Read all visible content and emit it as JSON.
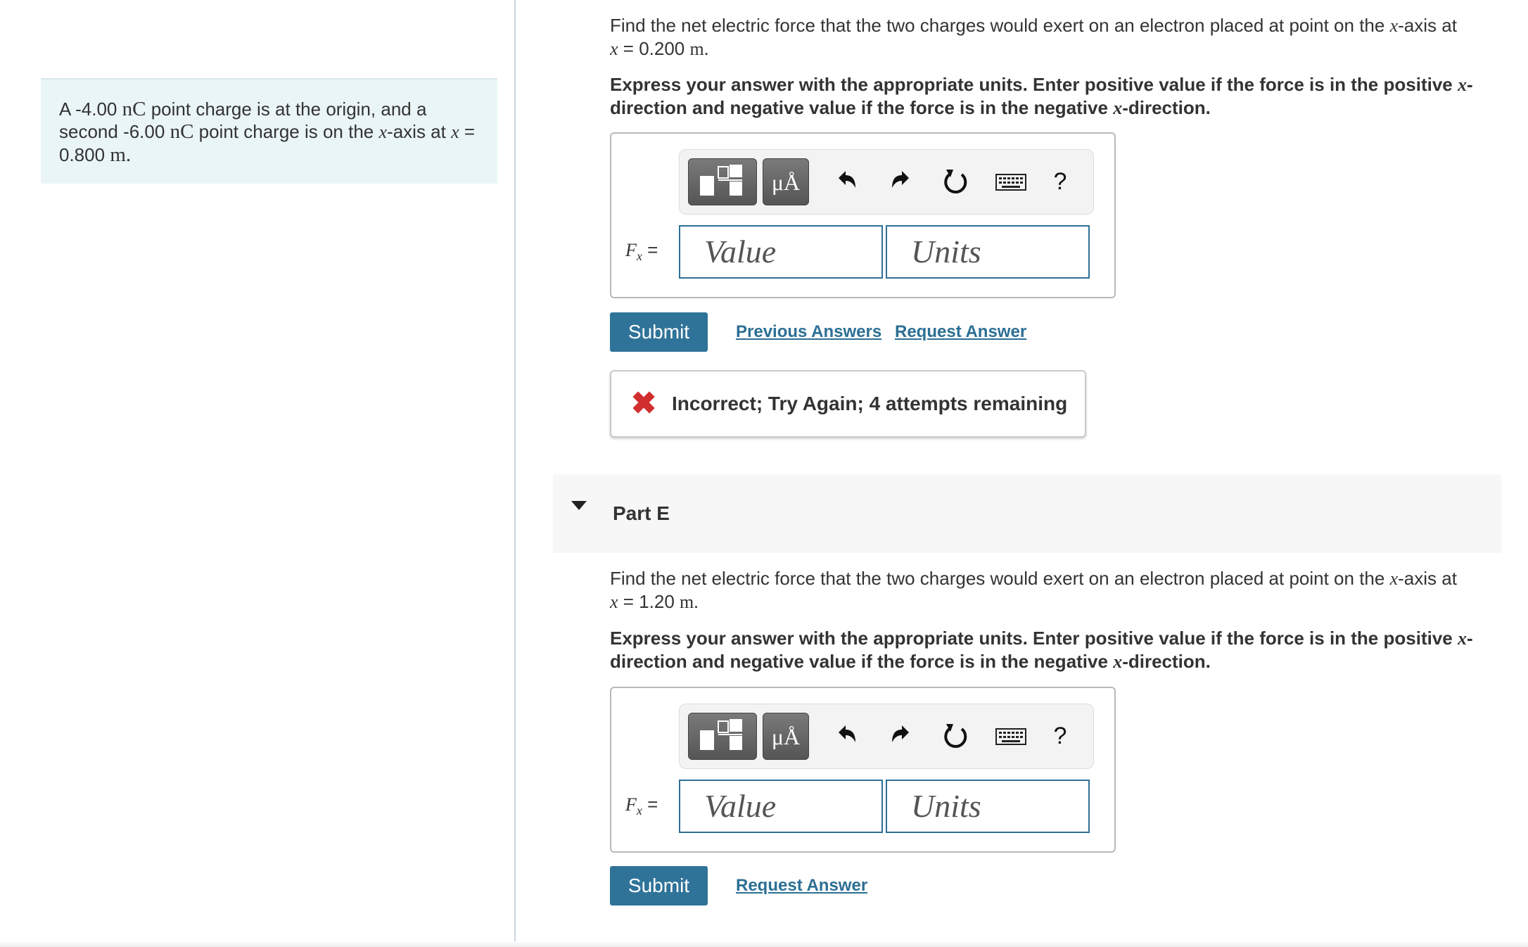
{
  "intro": {
    "t1": "A -4.00",
    "u1": "nC",
    "t2": "point charge is at the origin, and a second -6.00",
    "u2": "nC",
    "t3": "point charge is on the",
    "xvar": "x",
    "t4": "-axis at",
    "eq": "= 0.800",
    "unit": "m."
  },
  "partD": {
    "prompt_a": "Find the net electric force that the two charges would exert on an electron placed at point on the",
    "prompt_b": "-axis at",
    "xvar": "x",
    "eq": "= 0.200",
    "unit": "m.",
    "instr_a": "Express your answer with the appropriate units. Enter positive value if the force is in the positive",
    "instr_b": "-direction and negative value if the force is in the negative",
    "instr_c": "-direction.",
    "var_symbol": "F",
    "var_sub": "x",
    "var_eq": "=",
    "value_placeholder": "Value",
    "units_placeholder": "Units",
    "submit_label": "Submit",
    "prev_answers_label": "Previous Answers",
    "request_answer_label": "Request Answer",
    "feedback": "Incorrect; Try Again; 4 attempts remaining"
  },
  "partE": {
    "title": "Part E",
    "prompt_a": "Find the net electric force that the two charges would exert on an electron placed at point on the",
    "prompt_b": "-axis at",
    "xvar": "x",
    "eq": "= 1.20",
    "unit": "m.",
    "instr_a": "Express your answer with the appropriate units. Enter positive value if the force is in the positive",
    "instr_b": "-direction and negative value if the force is in the negative",
    "instr_c": "-direction.",
    "var_symbol": "F",
    "var_sub": "x",
    "var_eq": "=",
    "value_placeholder": "Value",
    "units_placeholder": "Units",
    "submit_label": "Submit",
    "request_answer_label": "Request Answer"
  },
  "toolbar": {
    "units_label": "μÅ",
    "help_label": "?",
    "icons": [
      "templates-icon",
      "units-icon",
      "undo-icon",
      "redo-icon",
      "reset-icon",
      "keyboard-icon",
      "help-icon"
    ]
  },
  "colors": {
    "accent": "#2f7399",
    "link": "#2c6f94",
    "error": "#d12f2f",
    "intro_bg": "#eaf5f7"
  }
}
